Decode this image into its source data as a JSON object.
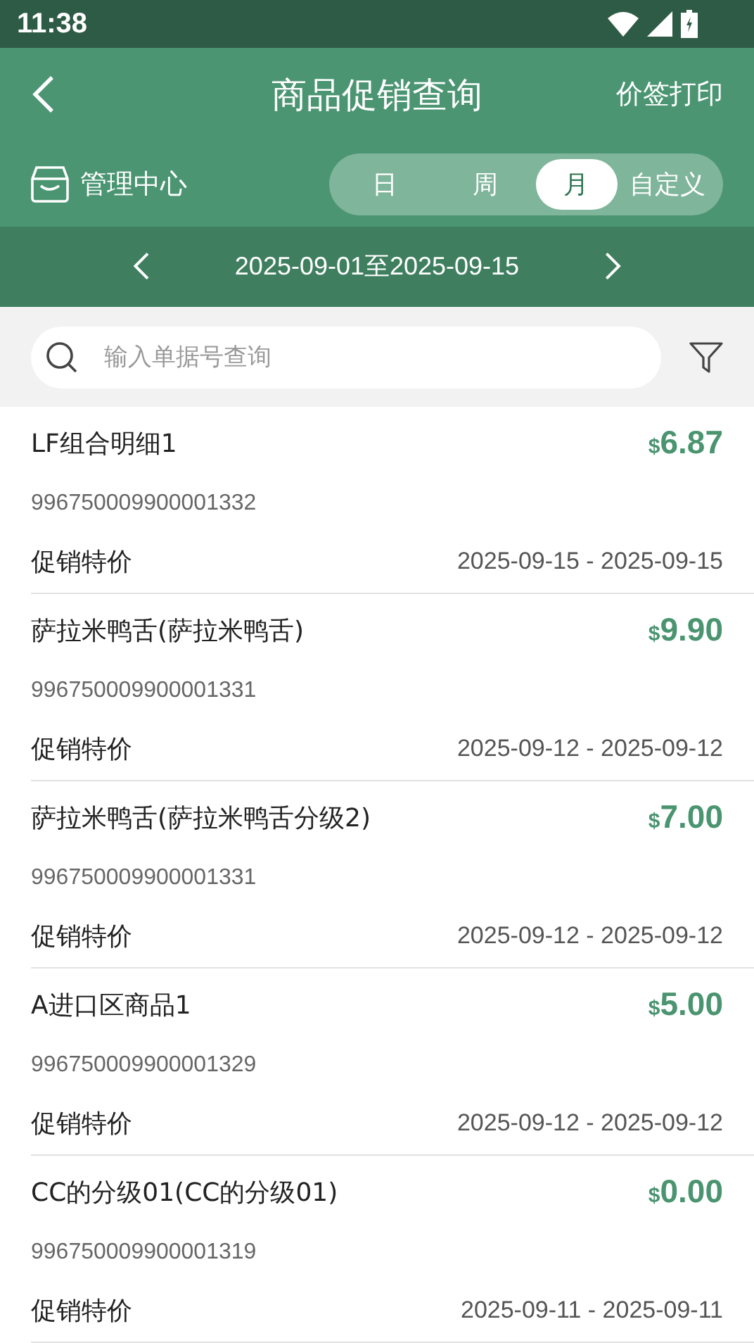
{
  "status_bar": {
    "time": "11:38"
  },
  "header": {
    "title": "商品促销查询",
    "action": "价签打印",
    "store": "管理中心"
  },
  "period_tabs": [
    {
      "label": "日",
      "selected": false
    },
    {
      "label": "周",
      "selected": false
    },
    {
      "label": "月",
      "selected": true
    },
    {
      "label": "自定义",
      "selected": false
    }
  ],
  "date_range": "2025-09-01至2025-09-15",
  "search": {
    "placeholder": "输入单据号查询"
  },
  "items": [
    {
      "name": "LF组合明细1",
      "code": "996750009900001332",
      "currency": "$",
      "price": "6.87",
      "type": "促销特价",
      "period": "2025-09-15 - 2025-09-15"
    },
    {
      "name": "萨拉米鸭舌(萨拉米鸭舌)",
      "code": "996750009900001331",
      "currency": "$",
      "price": "9.90",
      "type": "促销特价",
      "period": "2025-09-12 - 2025-09-12"
    },
    {
      "name": "萨拉米鸭舌(萨拉米鸭舌分级2)",
      "code": "996750009900001331",
      "currency": "$",
      "price": "7.00",
      "type": "促销特价",
      "period": "2025-09-12 - 2025-09-12"
    },
    {
      "name": "A进口区商品1",
      "code": "996750009900001329",
      "currency": "$",
      "price": "5.00",
      "type": "促销特价",
      "period": "2025-09-12 - 2025-09-12"
    },
    {
      "name": "CC的分级01(CC的分级01)",
      "code": "996750009900001319",
      "currency": "$",
      "price": "0.00",
      "type": "促销特价",
      "period": "2025-09-11 - 2025-09-11"
    }
  ]
}
